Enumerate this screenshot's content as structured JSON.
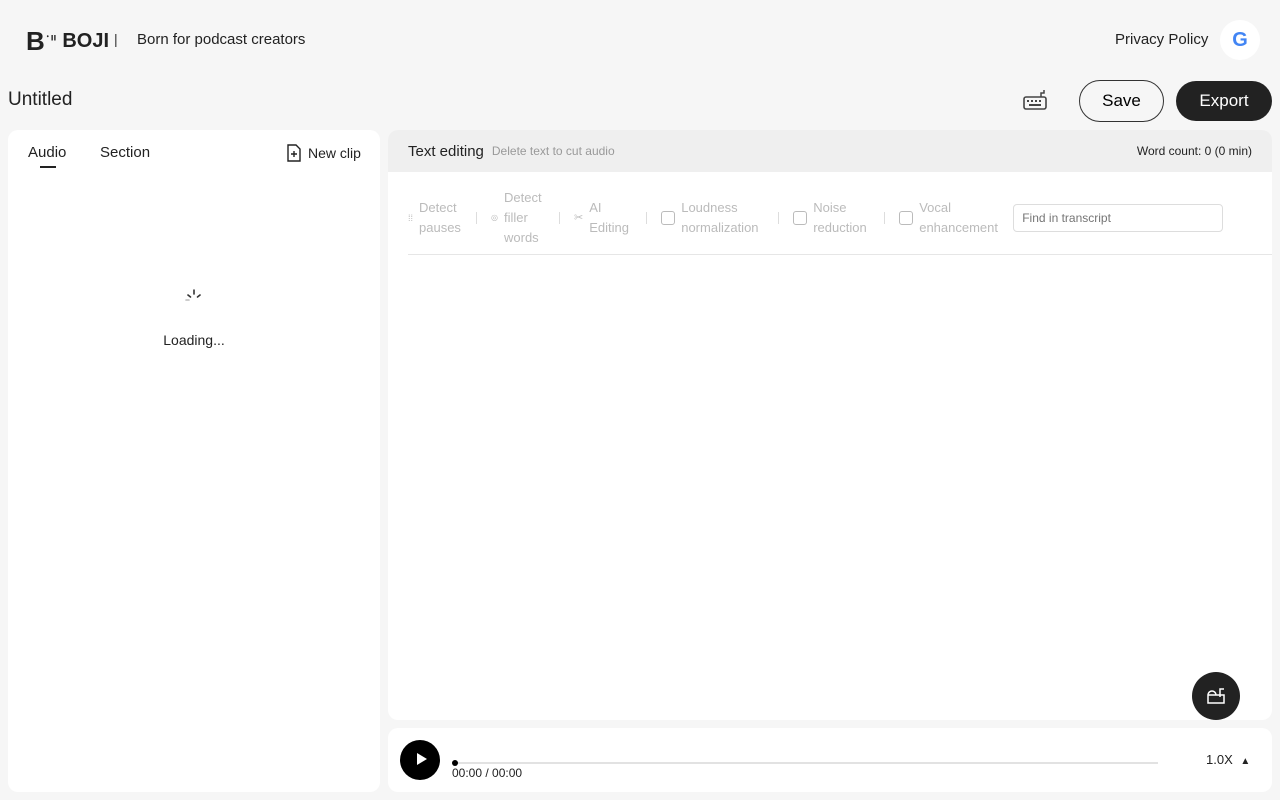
{
  "header": {
    "brand": "BOJI",
    "separator": "|",
    "tagline": "Born for podcast creators",
    "privacy_label": "Privacy Policy",
    "google_letter": "G"
  },
  "toolbar": {
    "doc_title": "Untitled",
    "save_label": "Save",
    "export_label": "Export"
  },
  "left_panel": {
    "tabs": [
      {
        "label": "Audio"
      },
      {
        "label": "Section"
      }
    ],
    "new_clip_label": "New clip",
    "loading_text": "Loading..."
  },
  "editor": {
    "title": "Text editing",
    "subtitle": "Delete text to cut audio",
    "word_count": "Word count: 0 (0 min)",
    "tools": [
      {
        "label": "Detect pauses"
      },
      {
        "label": "Detect filler words"
      },
      {
        "label": "AI Editing"
      },
      {
        "label": "Loudness normalization"
      },
      {
        "label": "Noise reduction"
      },
      {
        "label": "Vocal enhancement"
      }
    ],
    "find_placeholder": "Find in transcript"
  },
  "player": {
    "time": "00:00 / 00:00",
    "speed": "1.0X",
    "progress": 0
  }
}
